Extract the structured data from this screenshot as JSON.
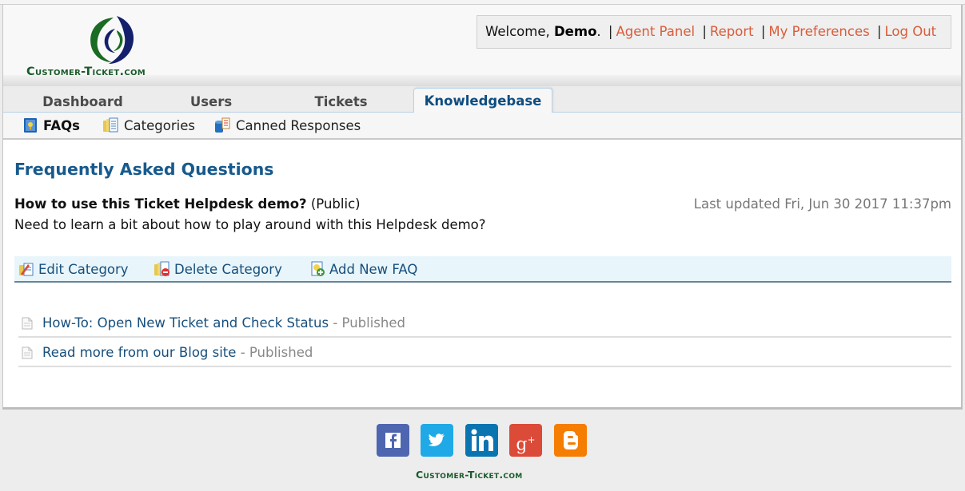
{
  "brand": {
    "name": "Customer-Ticket.com",
    "colors": {
      "green": "#1a5a2a",
      "navy": "#14206b",
      "link": "#d95c3a",
      "title": "#175a8d"
    }
  },
  "userbar": {
    "welcome": "Welcome,",
    "username": "Demo",
    "links": [
      "Agent Panel",
      "Report",
      "My Preferences",
      "Log Out"
    ]
  },
  "tabs": [
    {
      "label": "Dashboard",
      "active": false
    },
    {
      "label": "Users",
      "active": false
    },
    {
      "label": "Tickets",
      "active": false
    },
    {
      "label": "Knowledgebase",
      "active": true
    }
  ],
  "subnav": [
    {
      "label": "FAQs",
      "icon": "faq-book-icon",
      "active": true
    },
    {
      "label": "Categories",
      "icon": "categories-icon",
      "active": false
    },
    {
      "label": "Canned Responses",
      "icon": "canned-responses-icon",
      "active": false
    }
  ],
  "main": {
    "title": "Frequently Asked Questions",
    "category": {
      "name": "How to use this Ticket Helpdesk demo?",
      "visibility": "(Public)",
      "updated": "Last updated Fri, Jun 30 2017 11:37pm",
      "description": "Need to learn a bit about how to play around with this Helpdesk demo?"
    },
    "actions": [
      {
        "label": "Edit Category",
        "icon": "edit-category-icon"
      },
      {
        "label": "Delete Category",
        "icon": "delete-category-icon"
      },
      {
        "label": "Add New FAQ",
        "icon": "add-faq-icon"
      }
    ],
    "faqs": [
      {
        "title": "How-To: Open New Ticket and Check Status",
        "status": "- Published"
      },
      {
        "title": "Read more from our Blog site",
        "status": "- Published"
      }
    ]
  },
  "footer": {
    "social": [
      {
        "name": "facebook",
        "glyph": "f",
        "color": "#4e66b0"
      },
      {
        "name": "twitter",
        "glyph": "t",
        "color": "#1fa9e6"
      },
      {
        "name": "linkedin",
        "glyph": "in",
        "color": "#0a74b0"
      },
      {
        "name": "google-plus",
        "glyph": "g+",
        "color": "#dc4a38"
      },
      {
        "name": "blogger",
        "glyph": "B",
        "color": "#f57d00"
      }
    ],
    "brand_text": "Customer-Ticket.com"
  }
}
